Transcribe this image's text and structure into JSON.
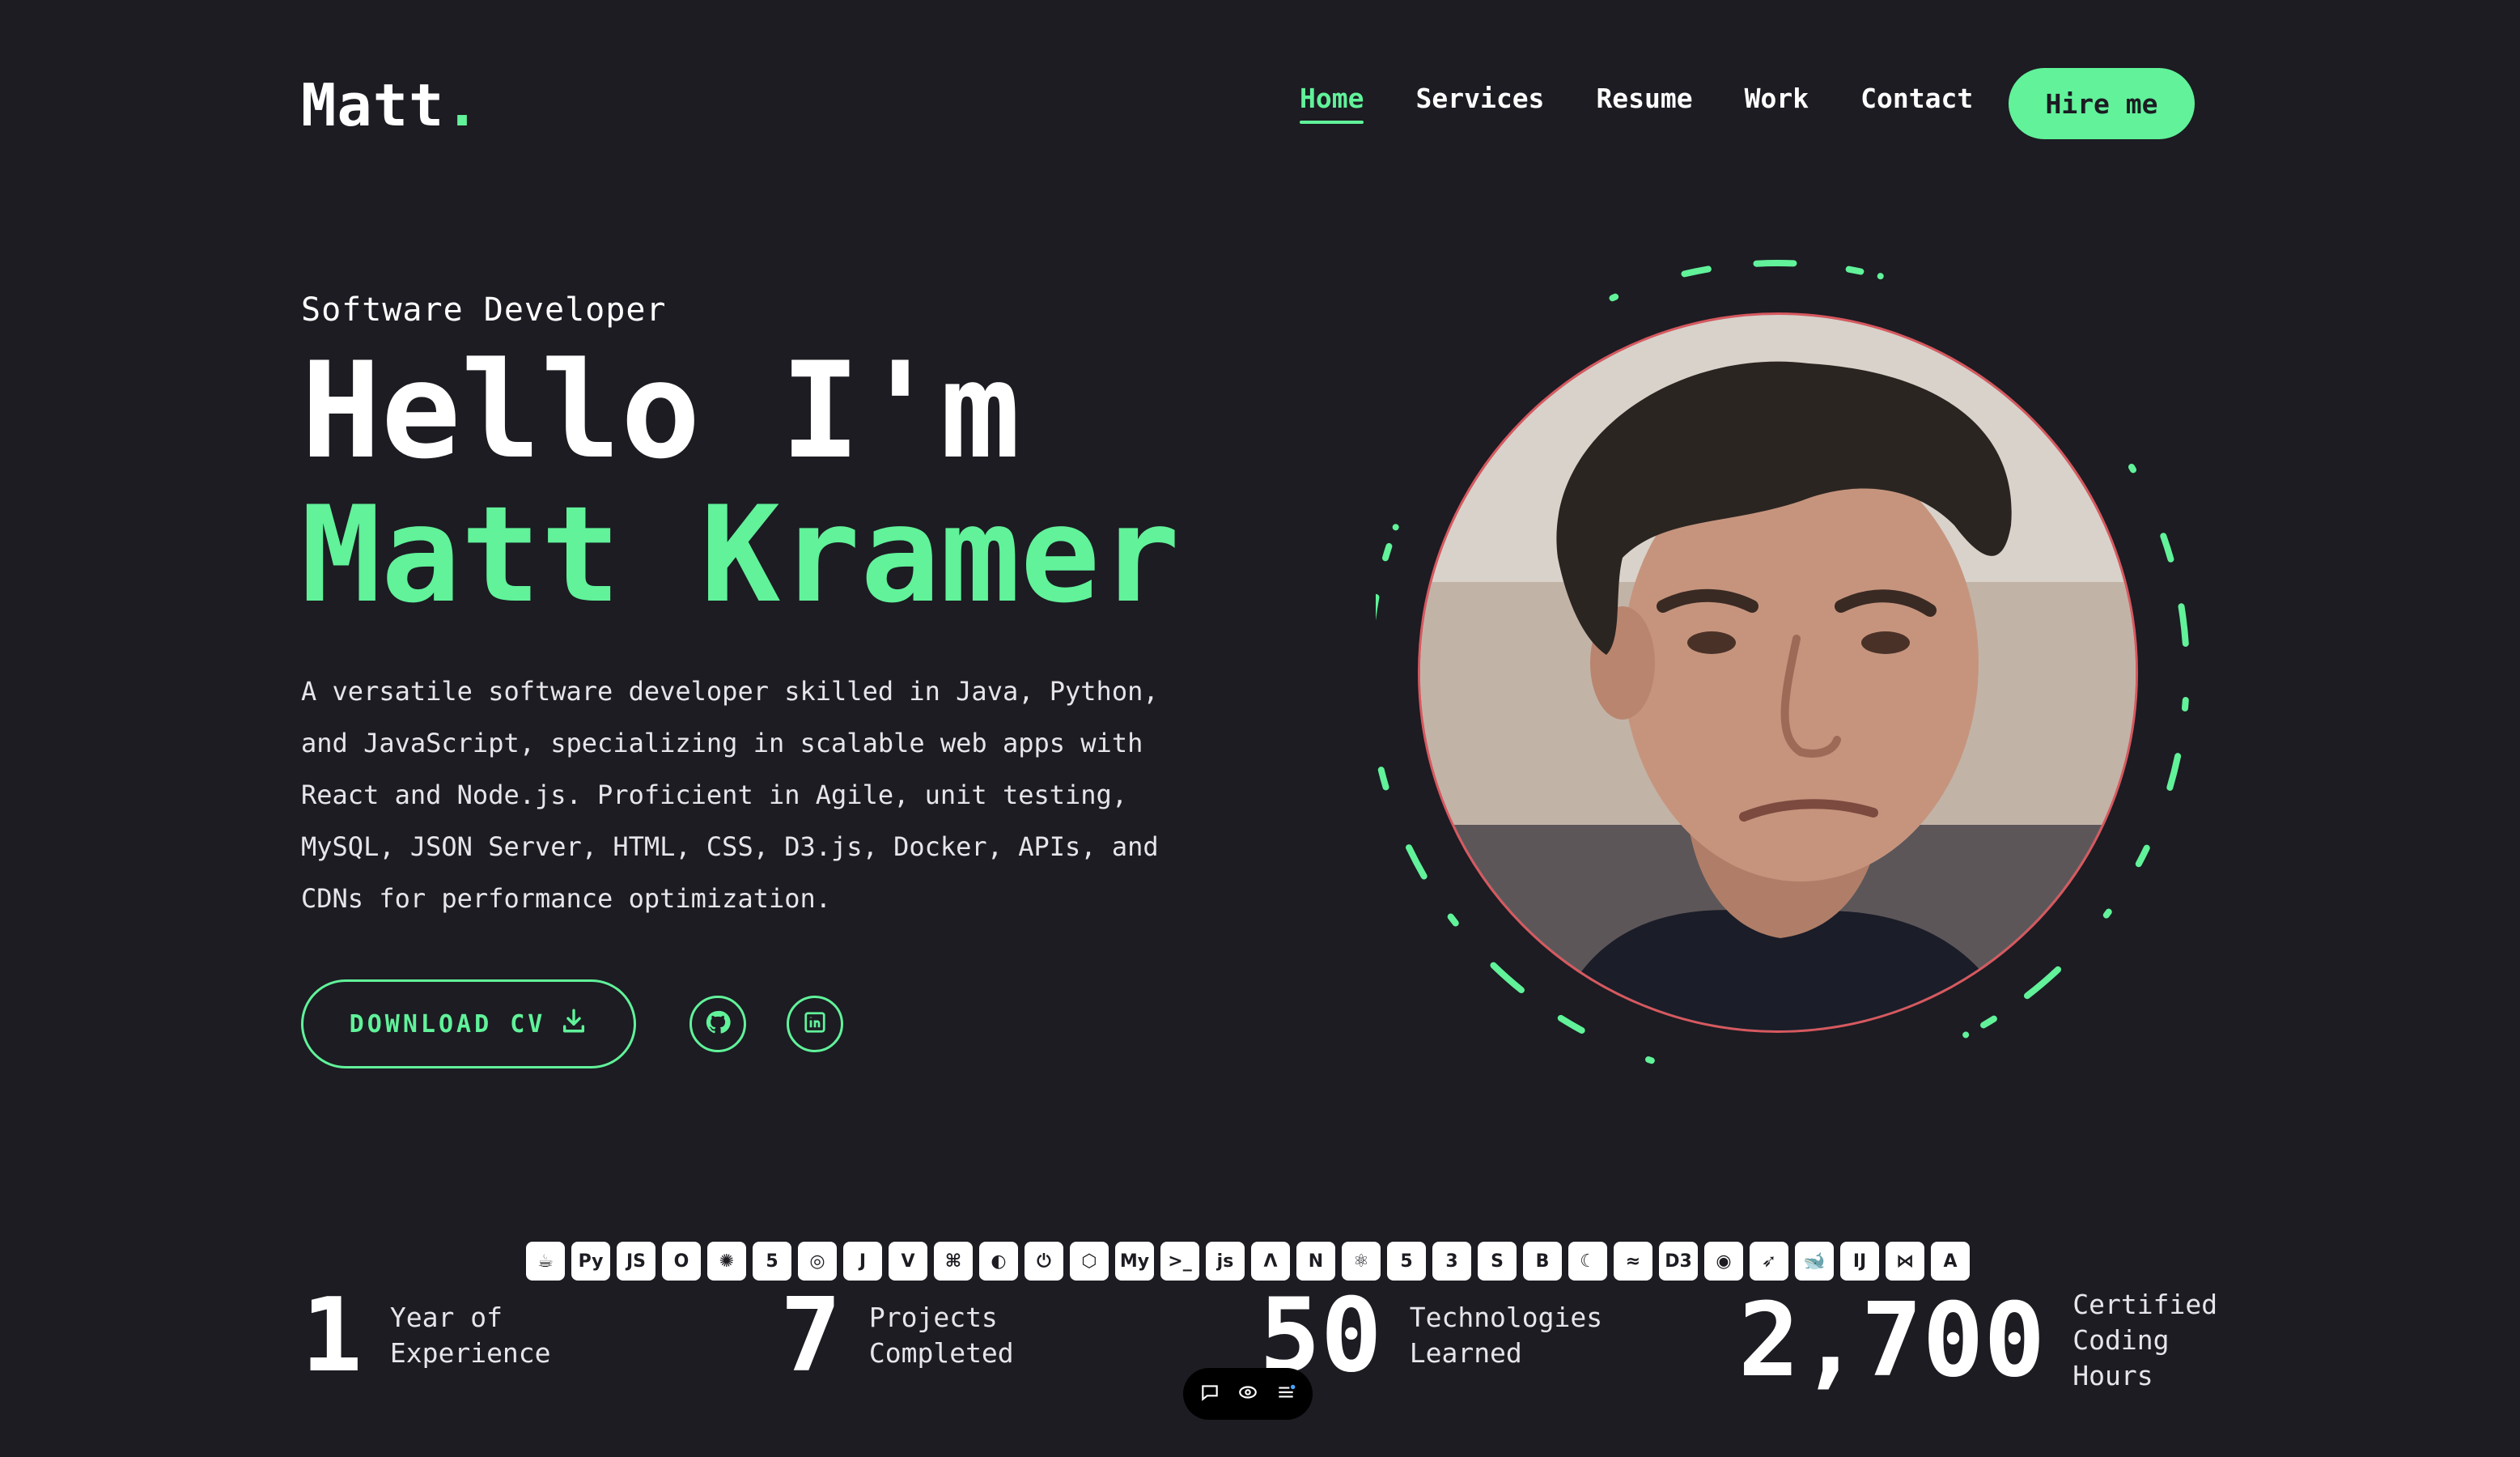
{
  "header": {
    "logo": "Matt",
    "logo_dot": ".",
    "nav": [
      {
        "label": "Home",
        "active": true
      },
      {
        "label": "Services",
        "active": false
      },
      {
        "label": "Resume",
        "active": false
      },
      {
        "label": "Work",
        "active": false
      },
      {
        "label": "Contact",
        "active": false
      }
    ],
    "hire_label": "Hire me"
  },
  "hero": {
    "role": "Software Developer",
    "greeting": "Hello I'm",
    "name": "Matt Kramer",
    "bio": "A versatile software developer skilled in Java, Python, and JavaScript, specializing in scalable web apps with React and Node.js. Proficient in Agile, unit testing, MySQL, JSON Server, HTML, CSS, D3.js, Docker, APIs, and CDNs for performance optimization.",
    "download_label": "DOWNLOAD CV",
    "socials": [
      "github-icon",
      "linkedin-icon"
    ]
  },
  "tech_icons": [
    {
      "name": "java-icon",
      "glyph": "☕"
    },
    {
      "name": "python-icon",
      "glyph": "Py"
    },
    {
      "name": "javascript-icon",
      "glyph": "JS"
    },
    {
      "name": "opera-icon",
      "glyph": "O"
    },
    {
      "name": "openai-icon",
      "glyph": "✺"
    },
    {
      "name": "html5-badge-icon",
      "glyph": "5"
    },
    {
      "name": "chromium-icon",
      "glyph": "◎"
    },
    {
      "name": "jest-icon",
      "glyph": "J"
    },
    {
      "name": "vuetify-icon",
      "glyph": "V"
    },
    {
      "name": "kubernetes-icon",
      "glyph": "⌘"
    },
    {
      "name": "pwa-icon",
      "glyph": "◐"
    },
    {
      "name": "power-icon",
      "glyph": "⏻"
    },
    {
      "name": "codesandbox-icon",
      "glyph": "⬡"
    },
    {
      "name": "mysql-icon",
      "glyph": "My"
    },
    {
      "name": "terminal-icon",
      "glyph": ">_"
    },
    {
      "name": "nodejs-icon",
      "glyph": "js"
    },
    {
      "name": "arch-icon",
      "glyph": "Λ"
    },
    {
      "name": "nextjs-icon",
      "glyph": "N"
    },
    {
      "name": "react-icon",
      "glyph": "⚛"
    },
    {
      "name": "html5-icon",
      "glyph": "5"
    },
    {
      "name": "css3-icon",
      "glyph": "3"
    },
    {
      "name": "sass-icon",
      "glyph": "S"
    },
    {
      "name": "bootstrap-icon",
      "glyph": "B"
    },
    {
      "name": "moon-icon",
      "glyph": "☾"
    },
    {
      "name": "tailwind-icon",
      "glyph": "≈"
    },
    {
      "name": "d3-icon",
      "glyph": "D3"
    },
    {
      "name": "github-icon",
      "glyph": "◉"
    },
    {
      "name": "postman-icon",
      "glyph": "➶"
    },
    {
      "name": "docker-icon",
      "glyph": "🐋"
    },
    {
      "name": "intellij-icon",
      "glyph": "IJ"
    },
    {
      "name": "vscode-icon",
      "glyph": "⋈"
    },
    {
      "name": "android-icon",
      "glyph": "A"
    }
  ],
  "stats": [
    {
      "value": "1",
      "label_line1": "Year of",
      "label_line2": "Experience",
      "label_line3": ""
    },
    {
      "value": "7",
      "label_line1": "Projects",
      "label_line2": "Completed",
      "label_line3": ""
    },
    {
      "value": "50",
      "label_line1": "Technologies",
      "label_line2": "Learned",
      "label_line3": ""
    },
    {
      "value": "2,700",
      "label_line1": "Certified",
      "label_line2": "Coding",
      "label_line3": "Hours"
    }
  ],
  "colors": {
    "accent": "#61f29a",
    "background": "#1c1c22",
    "photo_border": "#d8585f"
  }
}
